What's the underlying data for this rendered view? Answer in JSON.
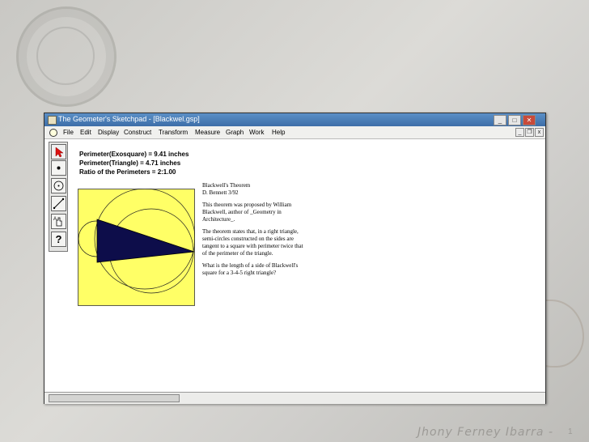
{
  "window": {
    "title": "The Geometer's Sketchpad - [Blackwel.gsp]",
    "controls": {
      "minimize": "_",
      "maximize": "□",
      "close": "✕"
    },
    "doc_controls": {
      "minimize": "_",
      "restore": "❐",
      "close": "x"
    }
  },
  "menu": {
    "items": [
      "File",
      "Edit",
      "Display",
      "Construct",
      "Transform",
      "Measure",
      "Graph",
      "Work",
      "Help"
    ]
  },
  "toolbox": {
    "tools": [
      "arrow-icon",
      "point-icon",
      "compass-icon",
      "straightedge-icon",
      "text-hand-icon",
      "help-icon"
    ],
    "help_glyph": "?"
  },
  "measurements": {
    "line1": "Perimeter(Exosquare) = 9.41 inches",
    "line2": "Perimeter(Triangle) = 4.71 inches",
    "line3": "Ratio of the Perimeters = 2:1.00"
  },
  "caption": {
    "p1a": "Blackwell's Theorem",
    "p1b": "D. Bennett 3/92",
    "p2": "This theorem was proposed by William Blackwell, author of _Geometry in Architecture_.",
    "p3": "The theorem states that, in a right triangle, semi-circles constructed on the sides are tangent to a square with perimeter twice that of the perimeter of the triangle.",
    "p4": "What is the length of a side of Blackwell's square for a 3-4-5 right triangle?"
  },
  "colors": {
    "square_fill": "#ffff66",
    "triangle_fill": "#0d0d4a",
    "titlebar": "#4a7fbb"
  },
  "footer": {
    "author": "Jhony Ferney Ibarra -",
    "page": "1"
  }
}
